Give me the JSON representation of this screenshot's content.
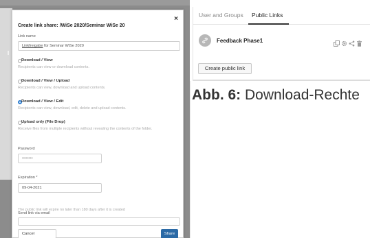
{
  "dialog": {
    "title": "Create link share: /WiSe 2020/Seminar WiSe 20",
    "close_label": "×",
    "link_name_label": "Link name",
    "link_name_value_underlined": "Linkfreigabe",
    "link_name_value_rest": " für Seminar WiSe 2020",
    "options": [
      {
        "title": "Download / View",
        "description": "Recipients can view or download contents.",
        "selected": false
      },
      {
        "title": "Download / View / Upload",
        "description": "Recipients can view, download and upload contents.",
        "selected": false
      },
      {
        "title": "Download / View / Edit",
        "description": "Recipients can view, download, edit, delete and upload contents.",
        "selected": true
      },
      {
        "title": "Upload only (File Drop)",
        "description": "Receive files from multiple recipients without revealing the contents of the folder.",
        "selected": false
      }
    ],
    "password_label": "Password",
    "password_value": "••••••••",
    "expiration_label": "Expiration *",
    "expiration_value": "09-04-2021",
    "expiration_note": "The public link will expire no later than 180 days after it is created",
    "email_label": "Send link via email",
    "cancel_label": "Cancel",
    "share_label": "Share"
  },
  "panel": {
    "tabs": [
      "User and Groups",
      "Public Links"
    ],
    "active_tab": "Public Links",
    "link_name": "Feedback Phase1",
    "row_action_icons": [
      "copy-icon",
      "gear-icon",
      "share-icon",
      "trash-icon"
    ],
    "create_button": "Create public link"
  },
  "caption": {
    "bold": "Abb. 6:",
    "text": " Download-Rechte"
  },
  "colors": {
    "accent": "#2f7fd1",
    "share_button": "#2b6aa6",
    "backdrop": "#8c8c8c"
  }
}
